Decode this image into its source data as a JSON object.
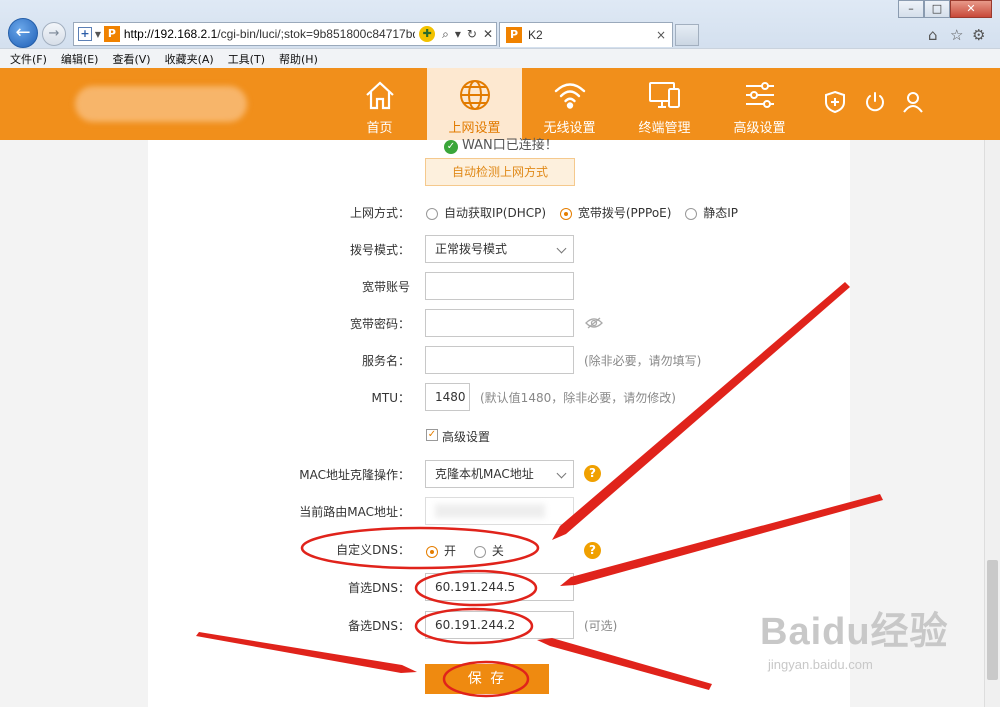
{
  "window": {
    "minimize": "–",
    "maximize": "□",
    "close": "✕"
  },
  "browser": {
    "back_icon": "back-arrow-icon",
    "url_host": "http://192.168.2.1",
    "url_path": "/cgi-bin/luci/;stok=9b851800c84717bd(",
    "tab_title": "K2",
    "tab_close": "×"
  },
  "menu": [
    "文件(F)",
    "编辑(E)",
    "查看(V)",
    "收藏夹(A)",
    "工具(T)",
    "帮助(H)"
  ],
  "nav": {
    "items": [
      {
        "label": "首页",
        "icon": "home-icon"
      },
      {
        "label": "上网设置",
        "icon": "globe-icon",
        "active": true
      },
      {
        "label": "无线设置",
        "icon": "wifi-icon"
      },
      {
        "label": "终端管理",
        "icon": "devices-icon"
      },
      {
        "label": "高级设置",
        "icon": "sliders-icon"
      }
    ],
    "colors": {
      "bar": "#f18f1b",
      "active_bg": "#fde8d0",
      "active_text": "#e27b00"
    }
  },
  "form": {
    "wan_status": "WAN口已连接！",
    "detect_button": "自动检测上网方式",
    "mode_label": "上网方式：",
    "mode_options": [
      "自动获取IP(DHCP)",
      "宽带拨号(PPPoE)",
      "静态IP"
    ],
    "dial_label": "拨号模式：",
    "dial_value": "正常拨号模式",
    "account_label": "宽带账号",
    "password_label": "宽带密码：",
    "service_label": "服务名：",
    "service_hint": "(除非必要，请勿填写)",
    "mtu_label": "MTU：",
    "mtu_value": "1480",
    "mtu_hint": "(默认值1480，除非必要，请勿修改)",
    "advanced_label": "高级设置",
    "mac_clone_label": "MAC地址克隆操作：",
    "mac_clone_value": "克隆本机MAC地址",
    "current_mac_label": "当前路由MAC地址：",
    "custom_dns_label": "自定义DNS：",
    "dns_on": "开",
    "dns_off": "关",
    "primary_dns_label": "首选DNS：",
    "primary_dns_value": "60.191.244.5",
    "secondary_dns_label": "备选DNS：",
    "secondary_dns_value": "60.191.244.2",
    "secondary_hint": "(可选)",
    "save_button": "保 存",
    "help_mark": "?"
  },
  "watermark": {
    "brand": "Baidu经验",
    "url": "jingyan.baidu.com"
  },
  "annotation_color": "#e0231b"
}
